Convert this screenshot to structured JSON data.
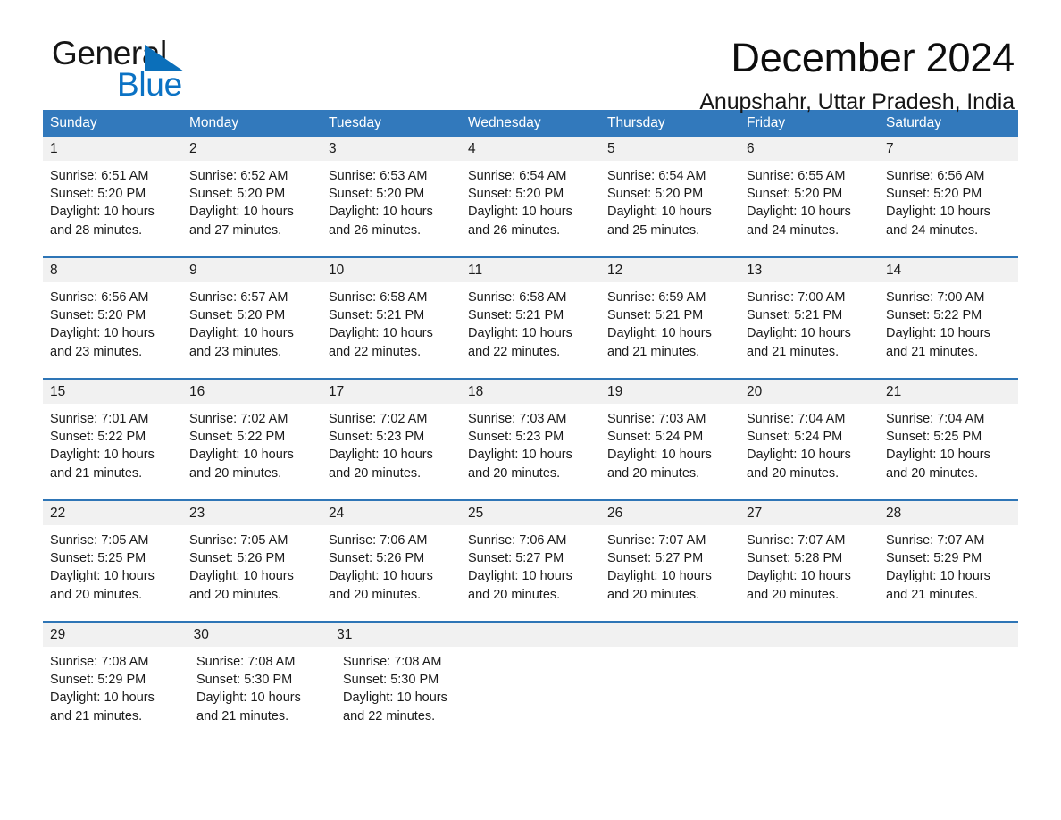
{
  "brand": {
    "name_part1": "General",
    "name_part2": "Blue",
    "logo_icon": "triangle-mark",
    "accent_color": "#0b72c4"
  },
  "header": {
    "month_title": "December 2024",
    "location": "Anupshahr, Uttar Pradesh, India"
  },
  "theme": {
    "header_blue": "#3279bc",
    "row_divider_blue": "#2e75b6",
    "daynum_band": "#f1f1f1",
    "text": "#1b1b1b"
  },
  "calendar": {
    "weekdays": [
      "Sunday",
      "Monday",
      "Tuesday",
      "Wednesday",
      "Thursday",
      "Friday",
      "Saturday"
    ],
    "weeks": [
      {
        "days": [
          {
            "num": "1",
            "sunrise": "Sunrise: 6:51 AM",
            "sunset": "Sunset: 5:20 PM",
            "daylight_l1": "Daylight: 10 hours",
            "daylight_l2": "and 28 minutes."
          },
          {
            "num": "2",
            "sunrise": "Sunrise: 6:52 AM",
            "sunset": "Sunset: 5:20 PM",
            "daylight_l1": "Daylight: 10 hours",
            "daylight_l2": "and 27 minutes."
          },
          {
            "num": "3",
            "sunrise": "Sunrise: 6:53 AM",
            "sunset": "Sunset: 5:20 PM",
            "daylight_l1": "Daylight: 10 hours",
            "daylight_l2": "and 26 minutes."
          },
          {
            "num": "4",
            "sunrise": "Sunrise: 6:54 AM",
            "sunset": "Sunset: 5:20 PM",
            "daylight_l1": "Daylight: 10 hours",
            "daylight_l2": "and 26 minutes."
          },
          {
            "num": "5",
            "sunrise": "Sunrise: 6:54 AM",
            "sunset": "Sunset: 5:20 PM",
            "daylight_l1": "Daylight: 10 hours",
            "daylight_l2": "and 25 minutes."
          },
          {
            "num": "6",
            "sunrise": "Sunrise: 6:55 AM",
            "sunset": "Sunset: 5:20 PM",
            "daylight_l1": "Daylight: 10 hours",
            "daylight_l2": "and 24 minutes."
          },
          {
            "num": "7",
            "sunrise": "Sunrise: 6:56 AM",
            "sunset": "Sunset: 5:20 PM",
            "daylight_l1": "Daylight: 10 hours",
            "daylight_l2": "and 24 minutes."
          }
        ]
      },
      {
        "days": [
          {
            "num": "8",
            "sunrise": "Sunrise: 6:56 AM",
            "sunset": "Sunset: 5:20 PM",
            "daylight_l1": "Daylight: 10 hours",
            "daylight_l2": "and 23 minutes."
          },
          {
            "num": "9",
            "sunrise": "Sunrise: 6:57 AM",
            "sunset": "Sunset: 5:20 PM",
            "daylight_l1": "Daylight: 10 hours",
            "daylight_l2": "and 23 minutes."
          },
          {
            "num": "10",
            "sunrise": "Sunrise: 6:58 AM",
            "sunset": "Sunset: 5:21 PM",
            "daylight_l1": "Daylight: 10 hours",
            "daylight_l2": "and 22 minutes."
          },
          {
            "num": "11",
            "sunrise": "Sunrise: 6:58 AM",
            "sunset": "Sunset: 5:21 PM",
            "daylight_l1": "Daylight: 10 hours",
            "daylight_l2": "and 22 minutes."
          },
          {
            "num": "12",
            "sunrise": "Sunrise: 6:59 AM",
            "sunset": "Sunset: 5:21 PM",
            "daylight_l1": "Daylight: 10 hours",
            "daylight_l2": "and 21 minutes."
          },
          {
            "num": "13",
            "sunrise": "Sunrise: 7:00 AM",
            "sunset": "Sunset: 5:21 PM",
            "daylight_l1": "Daylight: 10 hours",
            "daylight_l2": "and 21 minutes."
          },
          {
            "num": "14",
            "sunrise": "Sunrise: 7:00 AM",
            "sunset": "Sunset: 5:22 PM",
            "daylight_l1": "Daylight: 10 hours",
            "daylight_l2": "and 21 minutes."
          }
        ]
      },
      {
        "days": [
          {
            "num": "15",
            "sunrise": "Sunrise: 7:01 AM",
            "sunset": "Sunset: 5:22 PM",
            "daylight_l1": "Daylight: 10 hours",
            "daylight_l2": "and 21 minutes."
          },
          {
            "num": "16",
            "sunrise": "Sunrise: 7:02 AM",
            "sunset": "Sunset: 5:22 PM",
            "daylight_l1": "Daylight: 10 hours",
            "daylight_l2": "and 20 minutes."
          },
          {
            "num": "17",
            "sunrise": "Sunrise: 7:02 AM",
            "sunset": "Sunset: 5:23 PM",
            "daylight_l1": "Daylight: 10 hours",
            "daylight_l2": "and 20 minutes."
          },
          {
            "num": "18",
            "sunrise": "Sunrise: 7:03 AM",
            "sunset": "Sunset: 5:23 PM",
            "daylight_l1": "Daylight: 10 hours",
            "daylight_l2": "and 20 minutes."
          },
          {
            "num": "19",
            "sunrise": "Sunrise: 7:03 AM",
            "sunset": "Sunset: 5:24 PM",
            "daylight_l1": "Daylight: 10 hours",
            "daylight_l2": "and 20 minutes."
          },
          {
            "num": "20",
            "sunrise": "Sunrise: 7:04 AM",
            "sunset": "Sunset: 5:24 PM",
            "daylight_l1": "Daylight: 10 hours",
            "daylight_l2": "and 20 minutes."
          },
          {
            "num": "21",
            "sunrise": "Sunrise: 7:04 AM",
            "sunset": "Sunset: 5:25 PM",
            "daylight_l1": "Daylight: 10 hours",
            "daylight_l2": "and 20 minutes."
          }
        ]
      },
      {
        "days": [
          {
            "num": "22",
            "sunrise": "Sunrise: 7:05 AM",
            "sunset": "Sunset: 5:25 PM",
            "daylight_l1": "Daylight: 10 hours",
            "daylight_l2": "and 20 minutes."
          },
          {
            "num": "23",
            "sunrise": "Sunrise: 7:05 AM",
            "sunset": "Sunset: 5:26 PM",
            "daylight_l1": "Daylight: 10 hours",
            "daylight_l2": "and 20 minutes."
          },
          {
            "num": "24",
            "sunrise": "Sunrise: 7:06 AM",
            "sunset": "Sunset: 5:26 PM",
            "daylight_l1": "Daylight: 10 hours",
            "daylight_l2": "and 20 minutes."
          },
          {
            "num": "25",
            "sunrise": "Sunrise: 7:06 AM",
            "sunset": "Sunset: 5:27 PM",
            "daylight_l1": "Daylight: 10 hours",
            "daylight_l2": "and 20 minutes."
          },
          {
            "num": "26",
            "sunrise": "Sunrise: 7:07 AM",
            "sunset": "Sunset: 5:27 PM",
            "daylight_l1": "Daylight: 10 hours",
            "daylight_l2": "and 20 minutes."
          },
          {
            "num": "27",
            "sunrise": "Sunrise: 7:07 AM",
            "sunset": "Sunset: 5:28 PM",
            "daylight_l1": "Daylight: 10 hours",
            "daylight_l2": "and 20 minutes."
          },
          {
            "num": "28",
            "sunrise": "Sunrise: 7:07 AM",
            "sunset": "Sunset: 5:29 PM",
            "daylight_l1": "Daylight: 10 hours",
            "daylight_l2": "and 21 minutes."
          }
        ]
      },
      {
        "days": [
          {
            "num": "29",
            "sunrise": "Sunrise: 7:08 AM",
            "sunset": "Sunset: 5:29 PM",
            "daylight_l1": "Daylight: 10 hours",
            "daylight_l2": "and 21 minutes."
          },
          {
            "num": "30",
            "sunrise": "Sunrise: 7:08 AM",
            "sunset": "Sunset: 5:30 PM",
            "daylight_l1": "Daylight: 10 hours",
            "daylight_l2": "and 21 minutes."
          },
          {
            "num": "31",
            "sunrise": "Sunrise: 7:08 AM",
            "sunset": "Sunset: 5:30 PM",
            "daylight_l1": "Daylight: 10 hours",
            "daylight_l2": "and 22 minutes."
          },
          null,
          null,
          null,
          null
        ]
      }
    ]
  }
}
